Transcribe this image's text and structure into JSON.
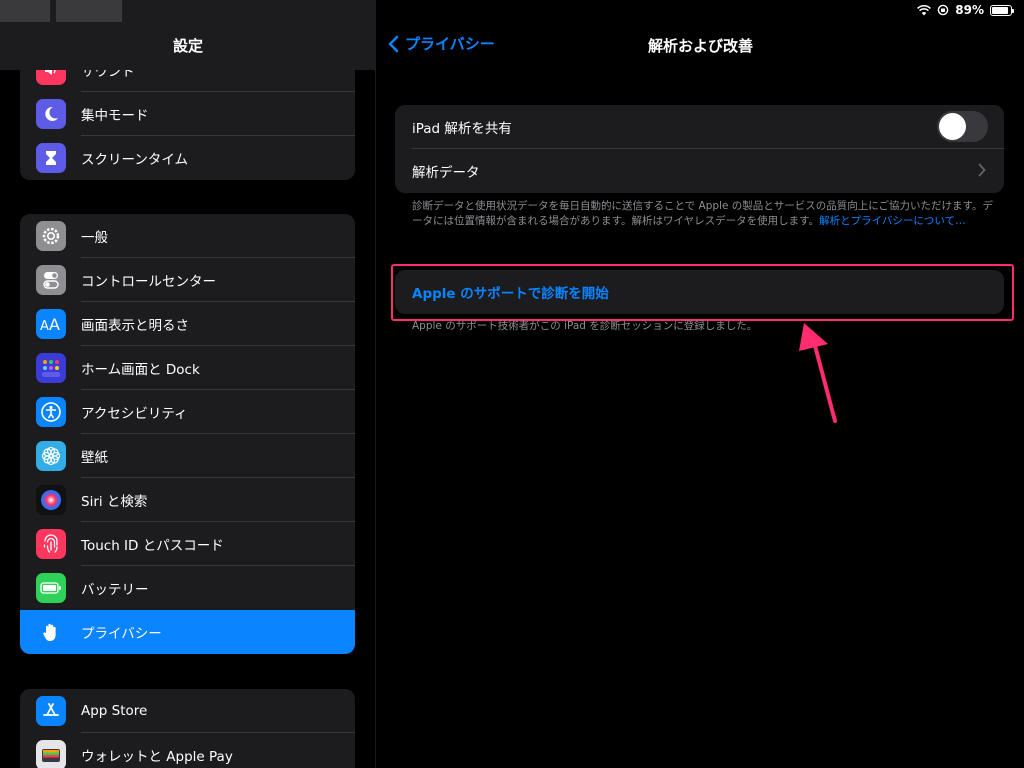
{
  "sidebar": {
    "title": "設定",
    "group1": [
      {
        "label": "サウンド",
        "icon": "speaker-icon",
        "color": "#ff375f"
      },
      {
        "label": "集中モード",
        "icon": "moon-icon",
        "color": "#5e5ce6"
      },
      {
        "label": "スクリーンタイム",
        "icon": "hourglass-icon",
        "color": "#5e5ce6"
      }
    ],
    "group2": [
      {
        "label": "一般",
        "icon": "gear-icon",
        "color": "#8e8e93"
      },
      {
        "label": "コントロールセンター",
        "icon": "toggles-icon",
        "color": "#8e8e93"
      },
      {
        "label": "画面表示と明るさ",
        "icon": "text-size-icon",
        "color": "#0a84ff"
      },
      {
        "label": "ホーム画面と Dock",
        "icon": "home-grid-icon",
        "color": "#3b3bd8"
      },
      {
        "label": "アクセシビリティ",
        "icon": "accessibility-icon",
        "color": "#0a84ff"
      },
      {
        "label": "壁紙",
        "icon": "flower-icon",
        "color": "#32ade6"
      },
      {
        "label": "Siri と検索",
        "icon": "siri-icon",
        "color": "#111111"
      },
      {
        "label": "Touch ID とパスコード",
        "icon": "fingerprint-icon",
        "color": "#ff375f"
      },
      {
        "label": "バッテリー",
        "icon": "battery-icon",
        "color": "#30d158"
      },
      {
        "label": "プライバシー",
        "icon": "hand-icon",
        "color": "#0a84ff",
        "selected": true
      }
    ],
    "group3": [
      {
        "label": "App Store",
        "icon": "app-store-icon",
        "color": "#0a84ff"
      },
      {
        "label": "ウォレットと Apple Pay",
        "icon": "wallet-icon",
        "color": "#3a3a3c"
      }
    ]
  },
  "status": {
    "battery": "89%",
    "battery_level": 0.89
  },
  "nav": {
    "back_label": "プライバシー",
    "title": "解析および改善"
  },
  "main": {
    "share_label": "iPad 解析を共有",
    "share_enabled": false,
    "data_label": "解析データ",
    "footnote_text": "診断データと使用状況データを毎日自動的に送信することで Apple の製品とサービスの品質向上にご協力いただけます。データには位置情報が含まれる場合があります。解析はワイヤレスデータを使用します。",
    "footnote_link": "解析とプライバシーについて…",
    "support_label": "Apple のサポートで診断を開始",
    "support_footnote": "Apple のサポート技術者がこの iPad を診断セッションに登録しました。"
  },
  "colors": {
    "accent": "#0a84ff",
    "highlight": "#ff2d6f",
    "arrow": "#ff2d6f"
  }
}
